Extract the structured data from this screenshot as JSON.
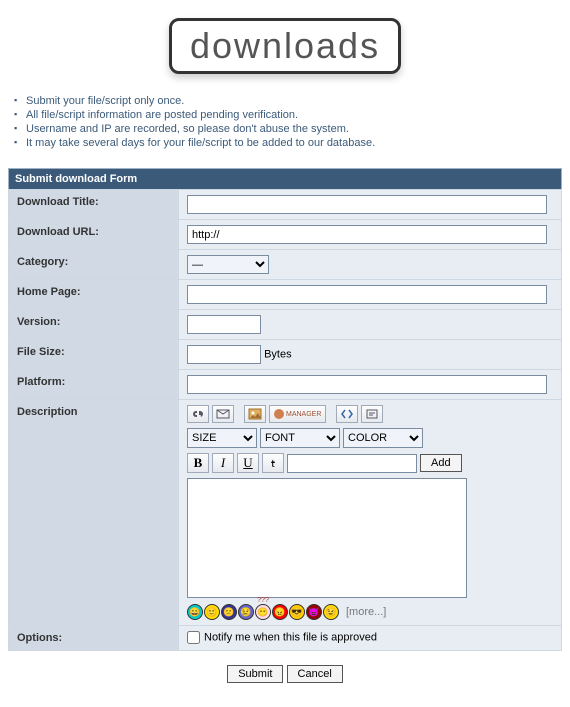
{
  "logo": {
    "text": "downloads"
  },
  "notes": [
    "Submit your file/script only once.",
    "All file/script information are posted pending verification.",
    "Username and IP are recorded, so please don't abuse the system.",
    "It may take several days for your file/script to be added to our database."
  ],
  "form": {
    "header": "Submit download Form",
    "rows": {
      "title_label": "Download Title:",
      "title_value": "",
      "url_label": "Download URL:",
      "url_value": "http://",
      "category_label": "Category:",
      "category_selected": "—",
      "homepage_label": "Home Page:",
      "homepage_value": "",
      "version_label": "Version:",
      "version_value": "",
      "filesize_label": "File Size:",
      "filesize_value": "",
      "filesize_unit": "Bytes",
      "platform_label": "Platform:",
      "platform_value": "",
      "description_label": "Description",
      "options_label": "Options:",
      "options_checkbox_label": "Notify me when this file is approved"
    },
    "editor": {
      "manager_label": "MANAGER",
      "size_label": "SIZE",
      "font_label": "FONT",
      "color_label": "COLOR",
      "bold_label": "B",
      "italic_label": "I",
      "underline_label": "U",
      "strike_label": "t",
      "add_label": "Add",
      "textarea_value": "",
      "url_input_value": "",
      "more_label": "[more...]"
    },
    "buttons": {
      "submit": "Submit",
      "cancel": "Cancel"
    }
  }
}
